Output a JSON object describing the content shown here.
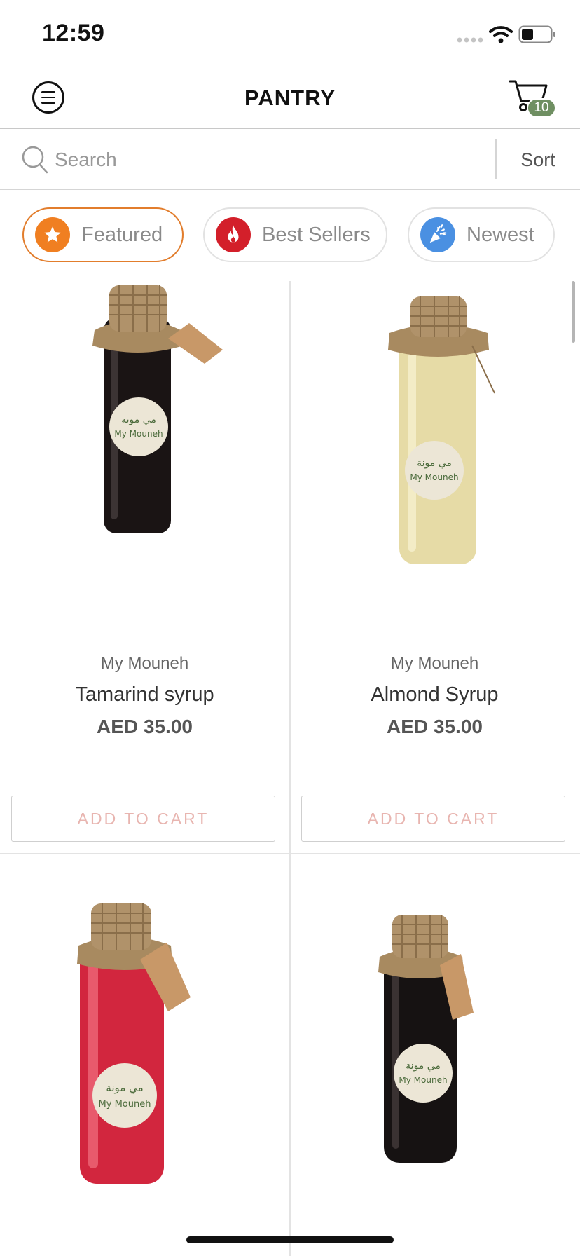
{
  "status_bar": {
    "time": "12:59"
  },
  "nav": {
    "title": "PANTRY",
    "cart_count": "10"
  },
  "search": {
    "placeholder": "Search",
    "value": "",
    "sort_label": "Sort"
  },
  "filters": [
    {
      "label": "Featured",
      "icon": "star-icon",
      "color": "#f07f21",
      "active": true
    },
    {
      "label": "Best Sellers",
      "icon": "flame-icon",
      "color": "#d31f2a",
      "active": false
    },
    {
      "label": "Newest",
      "icon": "party-popper-icon",
      "color": "#4a90e2",
      "active": false
    }
  ],
  "products": [
    {
      "brand": "My Mouneh",
      "name": "Tamarind syrup",
      "price": "AED 35.00",
      "button": "ADD TO CART",
      "liquid_color": "#1a1414"
    },
    {
      "brand": "My Mouneh",
      "name": "Almond Syrup",
      "price": "AED 35.00",
      "button": "ADD TO CART",
      "liquid_color": "#e6dba6"
    },
    {
      "brand": "",
      "name": "",
      "price": "",
      "button": "",
      "liquid_color": "#d2263e"
    },
    {
      "brand": "",
      "name": "",
      "price": "",
      "button": "",
      "liquid_color": "#161212"
    }
  ],
  "label_text": {
    "arabic": "مي مونة",
    "latin": "My Mouneh"
  },
  "colors": {
    "accent": "#e27d2c",
    "badge": "#6f8f62",
    "button_text": "#e8b5b0"
  }
}
